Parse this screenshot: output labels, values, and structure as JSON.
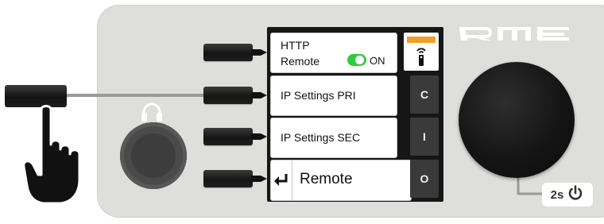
{
  "brand": {
    "logo_text": "RME"
  },
  "menu": {
    "http": {
      "line1": "HTTP",
      "line2": "Remote",
      "toggle_label": "ON",
      "toggle_color": "#2ecc40"
    },
    "ip_pri": {
      "label": "IP Settings PRI"
    },
    "ip_sec": {
      "label": "IP Settings SEC"
    },
    "back": {
      "label": "Remote"
    }
  },
  "tabs": [
    {
      "label": ""
    },
    {
      "label": "C"
    },
    {
      "label": "I"
    },
    {
      "label": "O"
    }
  ],
  "power_badge": {
    "label": "2s"
  },
  "colors": {
    "active_tab_accent": "#f0a028"
  },
  "icons": {
    "remote_tab": "remote-control-icon",
    "back": "return-arrow-icon",
    "headphones": "headphones-icon",
    "power": "power-icon",
    "hand": "pointing-hand-icon"
  }
}
